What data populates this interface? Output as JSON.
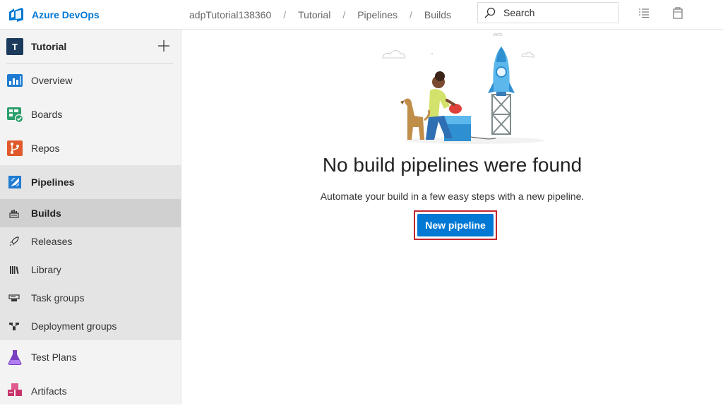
{
  "app": {
    "brand": "Azure DevOps"
  },
  "breadcrumb": [
    "adpTutorial138360",
    "Tutorial",
    "Pipelines",
    "Builds"
  ],
  "breadcrumb_separator": "/",
  "search": {
    "label": "Search"
  },
  "project": {
    "initial": "T",
    "name": "Tutorial"
  },
  "sidebar": {
    "items": [
      {
        "label": "Overview",
        "icon": "overview-icon"
      },
      {
        "label": "Boards",
        "icon": "boards-icon"
      },
      {
        "label": "Repos",
        "icon": "repos-icon"
      },
      {
        "label": "Pipelines",
        "icon": "pipelines-icon"
      },
      {
        "label": "Test Plans",
        "icon": "test-plans-icon"
      },
      {
        "label": "Artifacts",
        "icon": "artifacts-icon"
      }
    ],
    "pipelines_sub": [
      {
        "label": "Builds",
        "icon": "builds-icon"
      },
      {
        "label": "Releases",
        "icon": "releases-icon"
      },
      {
        "label": "Library",
        "icon": "library-icon"
      },
      {
        "label": "Task groups",
        "icon": "task-groups-icon"
      },
      {
        "label": "Deployment groups",
        "icon": "deployment-groups-icon"
      }
    ]
  },
  "empty_state": {
    "title": "No build pipelines were found",
    "description": "Automate your build in a few easy steps with a new pipeline.",
    "button": "New pipeline"
  },
  "colors": {
    "accent": "#0078d4",
    "highlight_border": "#c4262e",
    "sidebar_bg": "#f3f3f3",
    "selected_bg": "#d0d0d0"
  }
}
